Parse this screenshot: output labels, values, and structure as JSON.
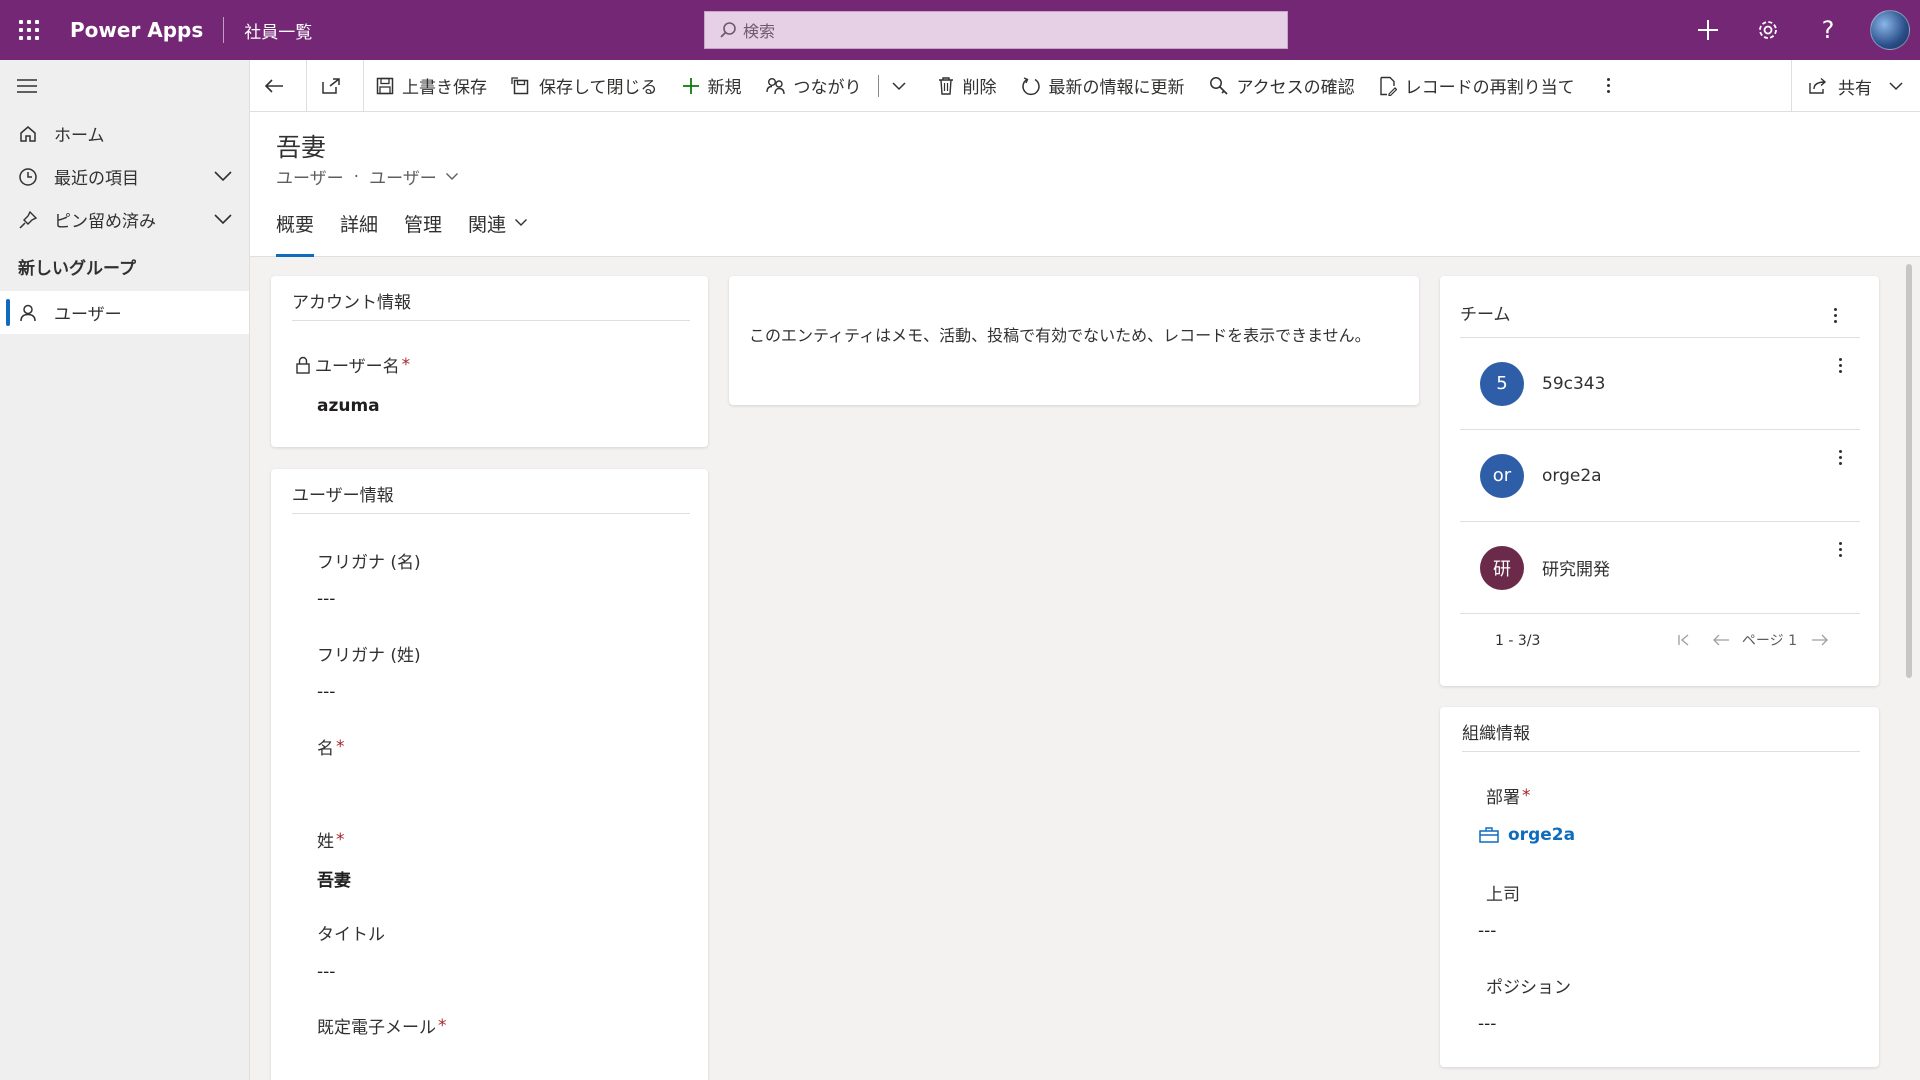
{
  "topbar": {
    "app_name": "Power Apps",
    "app_title": "社員一覧",
    "search_placeholder": "検索",
    "color": "#742774"
  },
  "nav": {
    "items": [
      {
        "label": "ホーム",
        "icon": "home-icon"
      },
      {
        "label": "最近の項目",
        "icon": "clock-icon"
      },
      {
        "label": "ピン留め済み",
        "icon": "pin-icon"
      }
    ],
    "group_label": "新しいグループ",
    "selected_item": {
      "label": "ユーザー",
      "icon": "person-icon"
    }
  },
  "commands": {
    "save": "上書き保存",
    "save_close": "保存して閉じる",
    "new": "新規",
    "connect": "つながり",
    "delete": "削除",
    "refresh": "最新の情報に更新",
    "check_access": "アクセスの確認",
    "reassign": "レコードの再割り当て",
    "share": "共有"
  },
  "header": {
    "title": "吾妻",
    "entity": "ユーザー",
    "form": "ユーザー",
    "tabs": [
      "概要",
      "詳細",
      "管理",
      "関連"
    ]
  },
  "account_card": {
    "title": "アカウント情報",
    "username_label": "ユーザー名",
    "username_value": "azuma"
  },
  "user_card": {
    "title": "ユーザー情報",
    "fields": [
      {
        "label": "フリガナ (名)",
        "value": "---",
        "required": false
      },
      {
        "label": "フリガナ (姓)",
        "value": "---",
        "required": false
      },
      {
        "label": "名",
        "value": "",
        "required": true
      },
      {
        "label": "姓",
        "value": "吾妻",
        "required": true
      },
      {
        "label": "タイトル",
        "value": "---",
        "required": false
      },
      {
        "label": "既定電子メール",
        "value": "",
        "required": true
      }
    ]
  },
  "timeline_card": {
    "message": "このエンティティはメモ、活動、投稿で有効でないため、レコードを表示できません。"
  },
  "team_card": {
    "title": "チーム",
    "teams": [
      {
        "initials": "5",
        "name": "59c343",
        "color": "#2e5ea8"
      },
      {
        "initials": "or",
        "name": "orge2a",
        "color": "#2e5ea8"
      },
      {
        "initials": "研",
        "name": "研究開発",
        "color": "#6b2a4a"
      }
    ],
    "range": "1 - 3/3",
    "page": "ページ 1"
  },
  "org_card": {
    "title": "組織情報",
    "department_label": "部署",
    "department_value": "orge2a",
    "manager_label": "上司",
    "manager_value": "---",
    "position_label": "ポジション",
    "position_value": "---"
  }
}
